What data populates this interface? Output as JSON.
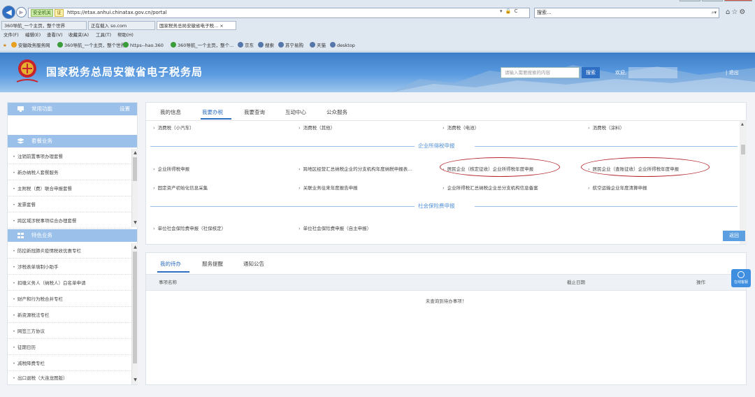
{
  "browser": {
    "secure_tag": "安全机关",
    "ssl_tag": "证",
    "url": "https://etax.anhui.chinatax.gov.cn/portal",
    "url_controls": "▾ 🔒 C",
    "search_placeholder": "搜索...",
    "tabs": [
      {
        "label": "360导航_一个主页，整个世界"
      },
      {
        "label": "正在载入 so.com"
      },
      {
        "label": "国家税务总局安徽省电子税...",
        "close": "×"
      }
    ],
    "menu": [
      "文件(F)",
      "编辑(E)",
      "查看(V)",
      "收藏夹(A)",
      "工具(T)",
      "帮助(H)"
    ],
    "favorites": [
      {
        "label": "安徽政务服务网",
        "color": "#e8a020"
      },
      {
        "label": "360导航_一个主页，整个世界",
        "color": "#3a9c3a"
      },
      {
        "label": "https--hao.360",
        "color": "#3a9c3a"
      },
      {
        "label": "360导航_一个主页，整个...",
        "color": "#3a9c3a"
      },
      {
        "label": "京东",
        "color": "#5577aa"
      },
      {
        "label": "搜索",
        "color": "#5577aa"
      },
      {
        "label": "苏宁易购",
        "color": "#5577aa"
      },
      {
        "label": "天猫",
        "color": "#5577aa"
      },
      {
        "label": "desktop",
        "color": "#5577aa"
      }
    ]
  },
  "banner": {
    "title": "国家税务总局安徽省电子税务局",
    "search_placeholder": "请输入需要搜索的内容",
    "search_button": "搜索",
    "welcome": "欢迎,",
    "logout": "退出"
  },
  "sidebar": {
    "common": {
      "title": "常用功能",
      "settings": "设置"
    },
    "package": {
      "title": "套餐业务",
      "items": [
        "注销前置事项办理套餐",
        "新办纳税人套餐服务",
        "主附税（费）联合申报套餐",
        "发票套餐",
        "跨区域涉税事项综合办理套餐"
      ]
    },
    "featured": {
      "title": "特色业务",
      "items": [
        "防控新冠肺炎疫情税收优惠专栏",
        "涉税表单填制小助手",
        "扣缴义务人（纳税人）白名单申请",
        "财产和行为税合并专栏",
        "新资源税法专栏",
        "网签三方协议",
        "征期日历",
        "减税降费专栏",
        "出口退税（大连龙图版）"
      ]
    }
  },
  "panel": {
    "tabs": [
      "我的信息",
      "我要办税",
      "我要查询",
      "互动中心",
      "公众服务"
    ],
    "active_tab": "我要办税",
    "top_links": [
      "消费税（小汽车）",
      "消费税（其他）",
      "消费税（电池）",
      "消费税（涂料）"
    ],
    "section1": "企业所得税申报",
    "section1_links_row1": [
      "企业所得税申报",
      "跨地区经营汇总纳税企业的分支机构年度纳税申报表...",
      "居民企业（核定征收）企业所得税年度申报",
      "居民企业（查账征收）企业所得税年度申报"
    ],
    "section1_links_row2": [
      "固定资产初始化信息采集",
      "关联业务往来年度报告申报",
      "企业所得税汇总纳税企业总分支机构信息备案",
      "航空运输企业年度清算申报"
    ],
    "section2": "社会保险费申报",
    "section2_links": [
      "单位社会保险费申报（社保核定）",
      "单位社会保险费申报（自主申报）"
    ],
    "back_button": "返回"
  },
  "lower": {
    "tabs": [
      "我的待办",
      "服务提醒",
      "通知公告"
    ],
    "active_tab": "我的待办",
    "columns": [
      "事项名称",
      "截止日期",
      "操作"
    ],
    "empty_message": "未查询到待办事项！"
  },
  "help_button": "在线客服",
  "colors": {
    "accent": "#2f6fc3",
    "section": "#4f8fd6",
    "highlight": "#b3262b",
    "sidebar_header": "#9bc0ea"
  }
}
